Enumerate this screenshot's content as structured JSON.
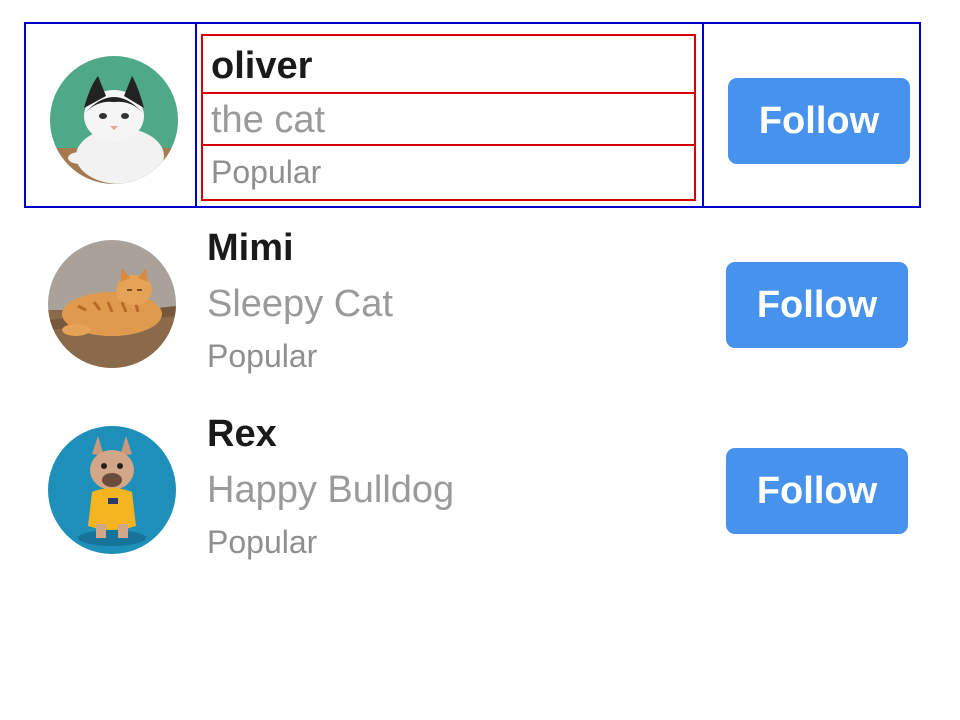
{
  "users": [
    {
      "name": "oliver",
      "subtitle": "the cat",
      "tag": "Popular",
      "follow_label": "Follow",
      "avatar": "black-white-cat-photo"
    },
    {
      "name": "Mimi",
      "subtitle": "Sleepy Cat",
      "tag": "Popular",
      "follow_label": "Follow",
      "avatar": "orange-tabby-cat-photo"
    },
    {
      "name": "Rex",
      "subtitle": "Happy Bulldog",
      "tag": "Popular",
      "follow_label": "Follow",
      "avatar": "french-bulldog-photo"
    }
  ],
  "colors": {
    "follow_button": "#4692ec",
    "name_text": "#1a1a1a",
    "secondary_text": "#9a9a9a"
  }
}
